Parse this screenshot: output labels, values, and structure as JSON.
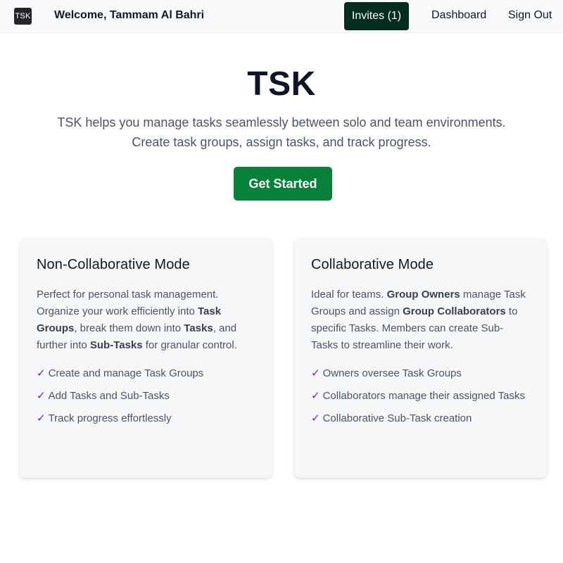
{
  "nav": {
    "logo_text": "TSK",
    "welcome": "Welcome, Tammam Al Bahri",
    "invites_label": "Invites (1)",
    "dashboard_label": "Dashboard",
    "signout_label": "Sign Out"
  },
  "hero": {
    "title": "TSK",
    "desc_line1": "TSK helps you manage tasks seamlessly between solo and team environments.",
    "desc_line2": "Create task groups, assign tasks, and track progress.",
    "cta_label": "Get Started"
  },
  "cards": {
    "non_collab": {
      "title": "Non-Collaborative Mode",
      "desc": [
        {
          "text": "Perfect for personal task management. Organize your work efficiently into ",
          "bold": false
        },
        {
          "text": "Task Groups",
          "bold": true
        },
        {
          "text": ", break them down into ",
          "bold": false
        },
        {
          "text": "Tasks",
          "bold": true
        },
        {
          "text": ", and further into ",
          "bold": false
        },
        {
          "text": "Sub-Tasks",
          "bold": true
        },
        {
          "text": " for granular control.",
          "bold": false
        }
      ],
      "features": [
        "Create and manage Task Groups",
        "Add Tasks and Sub-Tasks",
        "Track progress effortlessly"
      ]
    },
    "collab": {
      "title": "Collaborative Mode",
      "desc": [
        {
          "text": "Ideal for teams. ",
          "bold": false
        },
        {
          "text": "Group Owners",
          "bold": true
        },
        {
          "text": " manage Task Groups and assign ",
          "bold": false
        },
        {
          "text": "Group Collaborators",
          "bold": true
        },
        {
          "text": " to specific Tasks. Members can create Sub-Tasks to streamline their work.",
          "bold": false
        }
      ],
      "features": [
        "Owners oversee Task Groups",
        "Collaborators manage their assigned Tasks",
        "Collaborative Sub-Task creation"
      ]
    }
  },
  "check_glyph": "✓",
  "colors": {
    "nav_bg": "#f8f9fb",
    "invites_bg": "#032d1f",
    "cta_bg": "#08823a",
    "check": "#7b17c8",
    "card_bg": "#f6f7f9"
  }
}
